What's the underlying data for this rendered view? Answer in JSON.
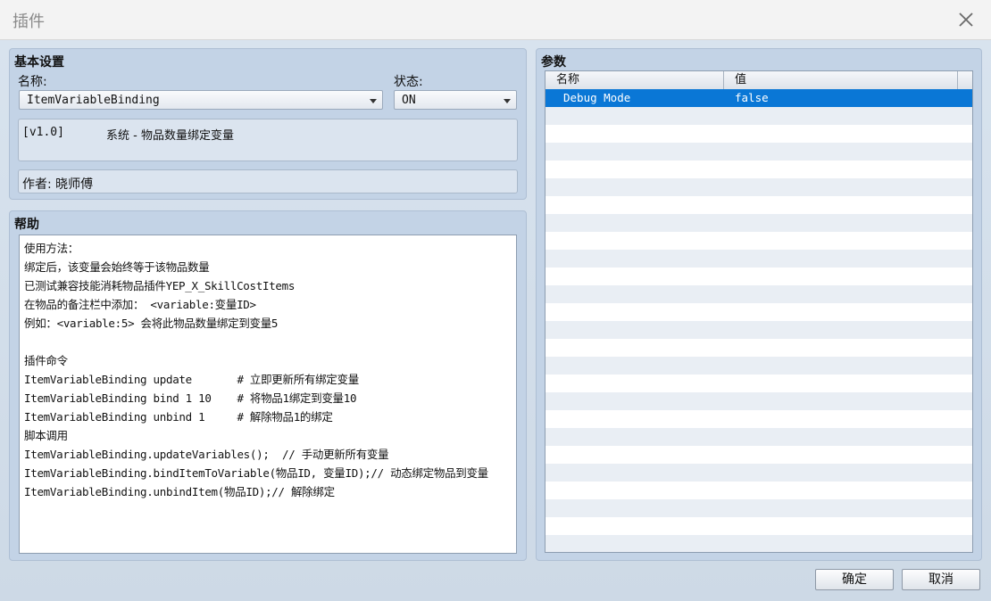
{
  "window": {
    "title": "插件"
  },
  "basic": {
    "section_title": "基本设置",
    "name_label": "名称:",
    "name_value": "ItemVariableBinding",
    "status_label": "状态:",
    "status_value": "ON",
    "version": "[v1.0]",
    "description": "系统 - 物品数量绑定变量",
    "author": "作者: 晓师傅"
  },
  "help": {
    "section_title": "帮助",
    "lines": [
      "使用方法：",
      "绑定后，该变量会始终等于该物品数量",
      "已测试兼容技能消耗物品插件YEP_X_SkillCostItems",
      "在物品的备注栏中添加： <variable:变量ID>",
      "例如：<variable:5> 会将此物品数量绑定到变量5",
      "",
      "插件命令",
      "ItemVariableBinding update       # 立即更新所有绑定变量",
      "ItemVariableBinding bind 1 10    # 将物品1绑定到变量10",
      "ItemVariableBinding unbind 1     # 解除物品1的绑定",
      "脚本调用",
      "ItemVariableBinding.updateVariables();  // 手动更新所有变量",
      "ItemVariableBinding.bindItemToVariable(物品ID, 变量ID);// 动态绑定物品到变量",
      "ItemVariableBinding.unbindItem(物品ID);// 解除绑定"
    ]
  },
  "params": {
    "section_title": "参数",
    "columns": [
      "名称",
      "值"
    ],
    "rows": [
      {
        "name": "Debug Mode",
        "value": "false",
        "selected": true
      }
    ]
  },
  "buttons": {
    "ok": "确定",
    "cancel": "取消"
  },
  "colors": {
    "selection": "#0a77d6",
    "panel": "#c3d3e6"
  }
}
